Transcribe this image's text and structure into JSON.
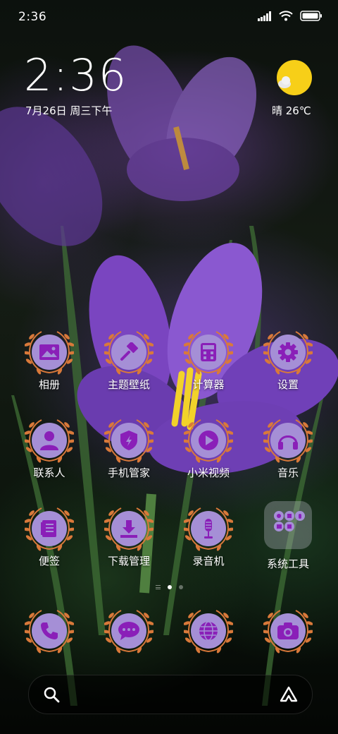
{
  "status_bar": {
    "time": "2:36"
  },
  "clock_widget": {
    "time": "2:36",
    "date": "7月26日 周三下午"
  },
  "weather": {
    "text": "晴 26℃"
  },
  "apps": [
    {
      "label": "相册",
      "icon": "gallery-icon"
    },
    {
      "label": "主题壁纸",
      "icon": "paintbrush-icon"
    },
    {
      "label": "计算器",
      "icon": "calculator-icon"
    },
    {
      "label": "设置",
      "icon": "gear-icon"
    },
    {
      "label": "联系人",
      "icon": "person-icon"
    },
    {
      "label": "手机管家",
      "icon": "shield-bolt-icon"
    },
    {
      "label": "小米视频",
      "icon": "play-icon"
    },
    {
      "label": "音乐",
      "icon": "headphones-icon"
    },
    {
      "label": "便签",
      "icon": "notepad-icon"
    },
    {
      "label": "下载管理",
      "icon": "download-icon"
    },
    {
      "label": "录音机",
      "icon": "microphone-icon"
    },
    {
      "label": "系统工具",
      "icon": "folder-icon"
    }
  ],
  "dock": [
    {
      "icon": "phone-icon"
    },
    {
      "icon": "message-icon"
    },
    {
      "icon": "globe-icon"
    },
    {
      "icon": "camera-icon"
    }
  ],
  "colors": {
    "icon_bg": "#a58fd6",
    "glyph": "#8a1fb8",
    "wreath": "#d9793a"
  }
}
